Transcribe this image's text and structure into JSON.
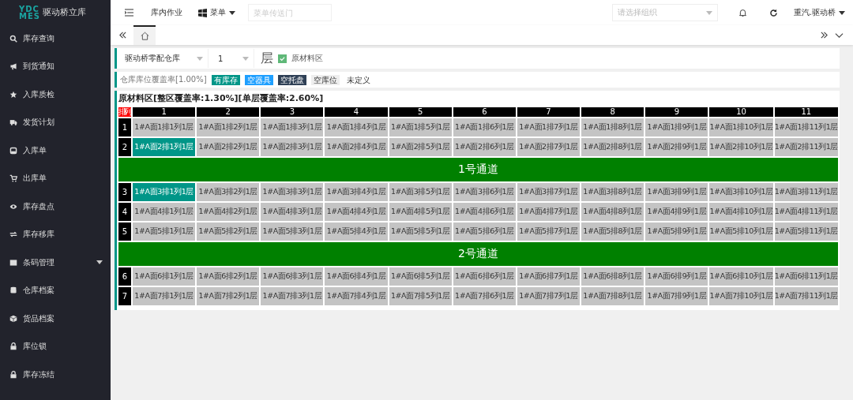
{
  "logo": {
    "mark_top": "YDC",
    "mark_bottom": "MES",
    "title": "驱动桥立库"
  },
  "sidebar": {
    "items": [
      {
        "label": "库存查询",
        "has_submenu": false
      },
      {
        "label": "到货通知",
        "has_submenu": false
      },
      {
        "label": "入库质检",
        "has_submenu": false
      },
      {
        "label": "发货计划",
        "has_submenu": false
      },
      {
        "label": "入库单",
        "has_submenu": false
      },
      {
        "label": "出库单",
        "has_submenu": false
      },
      {
        "label": "库存盘点",
        "has_submenu": false
      },
      {
        "label": "库存移库",
        "has_submenu": false
      },
      {
        "label": "条码管理",
        "has_submenu": true
      },
      {
        "label": "仓库档案",
        "has_submenu": false
      },
      {
        "label": "货品档案",
        "has_submenu": false
      },
      {
        "label": "库位锁",
        "has_submenu": false
      },
      {
        "label": "库存冻结",
        "has_submenu": false
      }
    ]
  },
  "topbar": {
    "module": "库内作业",
    "menu": "菜单",
    "menu_search_placeholder": "菜单传送门",
    "org_placeholder": "请选择组织",
    "user": "重汽.驱动桥"
  },
  "tabs": [
    {
      "kind": "home",
      "selected": true
    }
  ],
  "filters": {
    "warehouse": "驱动桥零配仓库",
    "layer": "1",
    "layer_label": "层",
    "area_checked": true,
    "area_label": "原材料区"
  },
  "legend": {
    "coverage": "仓库库位覆盖率[1.00%]",
    "items": [
      {
        "label": "有库存",
        "color": "#009688"
      },
      {
        "label": "空器具",
        "color": "#1e9fff"
      },
      {
        "label": "空托盘",
        "color": "#2f4056"
      },
      {
        "label": "空库位",
        "color": "#eeeeee"
      },
      {
        "label": "未定义",
        "color": "#ffffff"
      }
    ]
  },
  "area": {
    "title": "原材料区[整区覆盖率:1.30%][单层覆盖率:2.60%]",
    "corner": "排\\列",
    "columns": [
      "1",
      "2",
      "3",
      "4",
      "5",
      "6",
      "7",
      "8",
      "9",
      "10",
      "11"
    ],
    "rows": [
      {
        "kind": "row",
        "number": "1",
        "cells": [
          {
            "label": "1#A面1排1列1层",
            "occupied": false
          },
          {
            "label": "1#A面1排2列1层",
            "occupied": false
          },
          {
            "label": "1#A面1排3列1层",
            "occupied": false
          },
          {
            "label": "1#A面1排4列1层",
            "occupied": false
          },
          {
            "label": "1#A面1排5列1层",
            "occupied": false
          },
          {
            "label": "1#A面1排6列1层",
            "occupied": false
          },
          {
            "label": "1#A面1排7列1层",
            "occupied": false
          },
          {
            "label": "1#A面1排8列1层",
            "occupied": false
          },
          {
            "label": "1#A面1排9列1层",
            "occupied": false
          },
          {
            "label": "1#A面1排10列1层",
            "occupied": false
          },
          {
            "label": "1#A面1排11列1层",
            "occupied": false
          }
        ]
      },
      {
        "kind": "row",
        "number": "2",
        "cells": [
          {
            "label": "1#A面2排1列1层",
            "occupied": true
          },
          {
            "label": "1#A面2排2列1层",
            "occupied": false
          },
          {
            "label": "1#A面2排3列1层",
            "occupied": false
          },
          {
            "label": "1#A面2排4列1层",
            "occupied": false
          },
          {
            "label": "1#A面2排5列1层",
            "occupied": false
          },
          {
            "label": "1#A面2排6列1层",
            "occupied": false
          },
          {
            "label": "1#A面2排7列1层",
            "occupied": false
          },
          {
            "label": "1#A面2排8列1层",
            "occupied": false
          },
          {
            "label": "1#A面2排9列1层",
            "occupied": false
          },
          {
            "label": "1#A面2排10列1层",
            "occupied": false
          },
          {
            "label": "1#A面2排11列1层",
            "occupied": false
          }
        ]
      },
      {
        "kind": "aisle",
        "label": "1号通道"
      },
      {
        "kind": "row",
        "number": "3",
        "cells": [
          {
            "label": "1#A面3排1列1层",
            "occupied": true
          },
          {
            "label": "1#A面3排2列1层",
            "occupied": false
          },
          {
            "label": "1#A面3排3列1层",
            "occupied": false
          },
          {
            "label": "1#A面3排4列1层",
            "occupied": false
          },
          {
            "label": "1#A面3排5列1层",
            "occupied": false
          },
          {
            "label": "1#A面3排6列1层",
            "occupied": false
          },
          {
            "label": "1#A面3排7列1层",
            "occupied": false
          },
          {
            "label": "1#A面3排8列1层",
            "occupied": false
          },
          {
            "label": "1#A面3排9列1层",
            "occupied": false
          },
          {
            "label": "1#A面3排10列1层",
            "occupied": false
          },
          {
            "label": "1#A面3排11列1层",
            "occupied": false
          }
        ]
      },
      {
        "kind": "row",
        "number": "4",
        "cells": [
          {
            "label": "1#A面4排1列1层",
            "occupied": false
          },
          {
            "label": "1#A面4排2列1层",
            "occupied": false
          },
          {
            "label": "1#A面4排3列1层",
            "occupied": false
          },
          {
            "label": "1#A面4排4列1层",
            "occupied": false
          },
          {
            "label": "1#A面4排5列1层",
            "occupied": false
          },
          {
            "label": "1#A面4排6列1层",
            "occupied": false
          },
          {
            "label": "1#A面4排7列1层",
            "occupied": false
          },
          {
            "label": "1#A面4排8列1层",
            "occupied": false
          },
          {
            "label": "1#A面4排9列1层",
            "occupied": false
          },
          {
            "label": "1#A面4排10列1层",
            "occupied": false
          },
          {
            "label": "1#A面4排11列1层",
            "occupied": false
          }
        ]
      },
      {
        "kind": "row",
        "number": "5",
        "cells": [
          {
            "label": "1#A面5排1列1层",
            "occupied": false
          },
          {
            "label": "1#A面5排2列1层",
            "occupied": false
          },
          {
            "label": "1#A面5排3列1层",
            "occupied": false
          },
          {
            "label": "1#A面5排4列1层",
            "occupied": false
          },
          {
            "label": "1#A面5排5列1层",
            "occupied": false
          },
          {
            "label": "1#A面5排6列1层",
            "occupied": false
          },
          {
            "label": "1#A面5排7列1层",
            "occupied": false
          },
          {
            "label": "1#A面5排8列1层",
            "occupied": false
          },
          {
            "label": "1#A面5排9列1层",
            "occupied": false
          },
          {
            "label": "1#A面5排10列1层",
            "occupied": false
          },
          {
            "label": "1#A面5排11列1层",
            "occupied": false
          }
        ]
      },
      {
        "kind": "aisle",
        "label": "2号通道"
      },
      {
        "kind": "row",
        "number": "6",
        "cells": [
          {
            "label": "1#A面6排1列1层",
            "occupied": false
          },
          {
            "label": "1#A面6排2列1层",
            "occupied": false
          },
          {
            "label": "1#A面6排3列1层",
            "occupied": false
          },
          {
            "label": "1#A面6排4列1层",
            "occupied": false
          },
          {
            "label": "1#A面6排5列1层",
            "occupied": false
          },
          {
            "label": "1#A面6排6列1层",
            "occupied": false
          },
          {
            "label": "1#A面6排7列1层",
            "occupied": false
          },
          {
            "label": "1#A面6排8列1层",
            "occupied": false
          },
          {
            "label": "1#A面6排9列1层",
            "occupied": false
          },
          {
            "label": "1#A面6排10列1层",
            "occupied": false
          },
          {
            "label": "1#A面6排11列1层",
            "occupied": false
          }
        ]
      },
      {
        "kind": "row",
        "number": "7",
        "cells": [
          {
            "label": "1#A面7排1列1层",
            "occupied": false
          },
          {
            "label": "1#A面7排2列1层",
            "occupied": false
          },
          {
            "label": "1#A面7排3列1层",
            "occupied": false
          },
          {
            "label": "1#A面7排4列1层",
            "occupied": false
          },
          {
            "label": "1#A面7排5列1层",
            "occupied": false
          },
          {
            "label": "1#A面7排6列1层",
            "occupied": false
          },
          {
            "label": "1#A面7排7列1层",
            "occupied": false
          },
          {
            "label": "1#A面7排8列1层",
            "occupied": false
          },
          {
            "label": "1#A面7排9列1层",
            "occupied": false
          },
          {
            "label": "1#A面7排10列1层",
            "occupied": false
          },
          {
            "label": "1#A面7排11列1层",
            "occupied": false
          }
        ]
      }
    ]
  }
}
